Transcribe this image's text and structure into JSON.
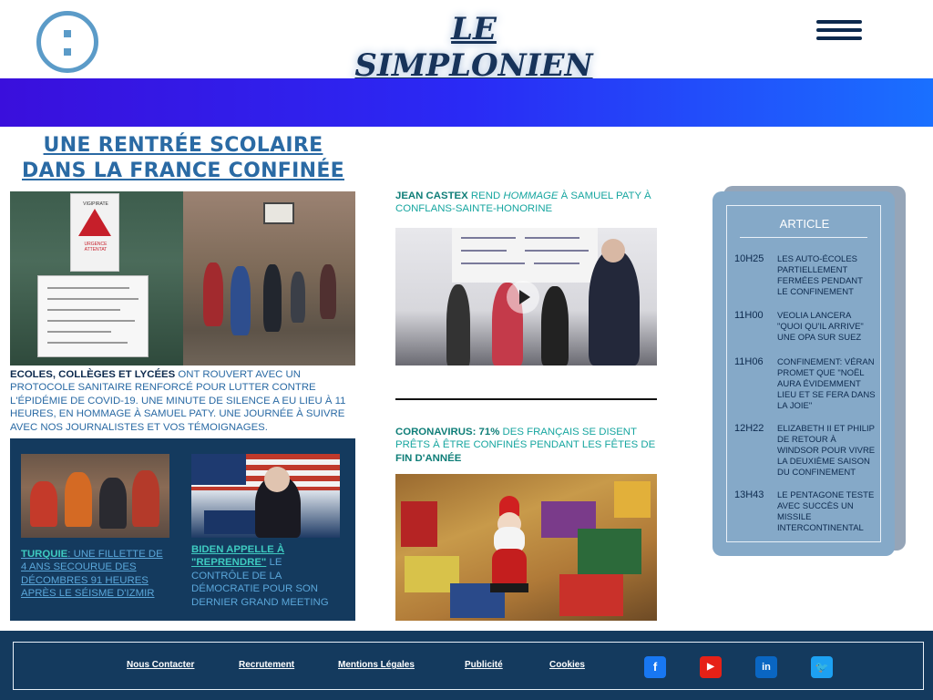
{
  "header": {
    "site_title": "LE SIMPLONIEN",
    "logo_icon": "colon-logo-icon",
    "menu_icon": "hamburger-menu-icon"
  },
  "main_story": {
    "headline": "UNE RENTRÉE SCOLAIRE DANS LA FRANCE CONFINÉE",
    "lead_bold": "ECOLES, COLLÈGES ET LYCÉES",
    "lead_text": " ONT ROUVERT AVEC UN PROTOCOLE SANITAIRE RENFORCÉ POUR LUTTER CONTRE L'ÉPIDÉMIE DE COVID-19. UNE MINUTE DE SILENCE A EU LIEU À 11 HEURES, EN HOMMAGE À SAMUEL PATY. UNE JOURNÉE À SUIVRE AVEC NOS JOURNALISTES ET VOS TÉMOIGNAGES.",
    "sign_title": "VIGIPIRATE",
    "sign_subtitle": "URGENCE ATTENTAT"
  },
  "secondary_stories": [
    {
      "bold": "TURQUIE",
      "text": ": UNE FILLETTE DE 4 ANS SECOURUE DES DÉCOMBRES 91 HEURES APRÈS LE SÉISME D'IZMIR"
    },
    {
      "bold": "BIDEN APPELLE À \"REPRENDRE\"",
      "text": " LE CONTRÔLE DE LA DÉMOCRATIE POUR SON DERNIER GRAND MEETING"
    }
  ],
  "middle_stories": [
    {
      "bold": "JEAN CASTEX",
      "text_1": " REND ",
      "italic": "HOMMAGE",
      "text_2": " À SAMUEL PATY À CONFLANS-SAINTE-HONORINE"
    },
    {
      "bold_1": "CORONAVIRUS: 71%",
      "text": " DES FRANÇAIS SE DISENT PRÊTS À ÊTRE CONFINÉS PENDANT LES FÊTES DE ",
      "bold_2": "FIN D'ANNÉE"
    }
  ],
  "sidebar": {
    "title": "ARTICLE",
    "items": [
      {
        "time": "10H25",
        "text": "LES AUTO-ÉCOLES PARTIELLEMENT FERMÉES PENDANT LE CONFINEMENT"
      },
      {
        "time": "11H00",
        "text": "VEOLIA LANCERA \"QUOI QU'IL ARRIVE\" UNE OPA SUR SUEZ"
      },
      {
        "time": "11H06",
        "text": "CONFINEMENT: VÉRAN PROMET QUE \"NOËL AURA ÉVIDEMMENT LIEU ET SE FERA DANS LA JOIE\""
      },
      {
        "time": "12H22",
        "text": "ELIZABETH II ET PHILIP DE RETOUR À WINDSOR POUR VIVRE LA DEUXIÈME SAISON DU CONFINEMENT"
      },
      {
        "time": "13H43",
        "text": "LE PENTAGONE TESTE AVEC SUCCÈS UN MISSILE INTERCONTINENTAL"
      }
    ]
  },
  "footer": {
    "links": [
      "Nous Contacter",
      "Recrutement",
      "Mentions Légales",
      "Publicité",
      "Cookies"
    ],
    "social": [
      {
        "name": "facebook-icon",
        "glyph": "f",
        "color": "#1877f2"
      },
      {
        "name": "youtube-icon",
        "glyph": "▶",
        "color": "#e62117"
      },
      {
        "name": "linkedin-icon",
        "glyph": "in",
        "color": "#0a66c2"
      },
      {
        "name": "twitter-icon",
        "glyph": "🐦",
        "color": "#1da1f2"
      }
    ]
  },
  "colors": {
    "brand_dark": "#143a5e",
    "accent_teal": "#17a6a0",
    "accent_blue": "#2a6aa4",
    "banner_start": "#3a0fdc",
    "banner_end": "#1a70ff"
  }
}
